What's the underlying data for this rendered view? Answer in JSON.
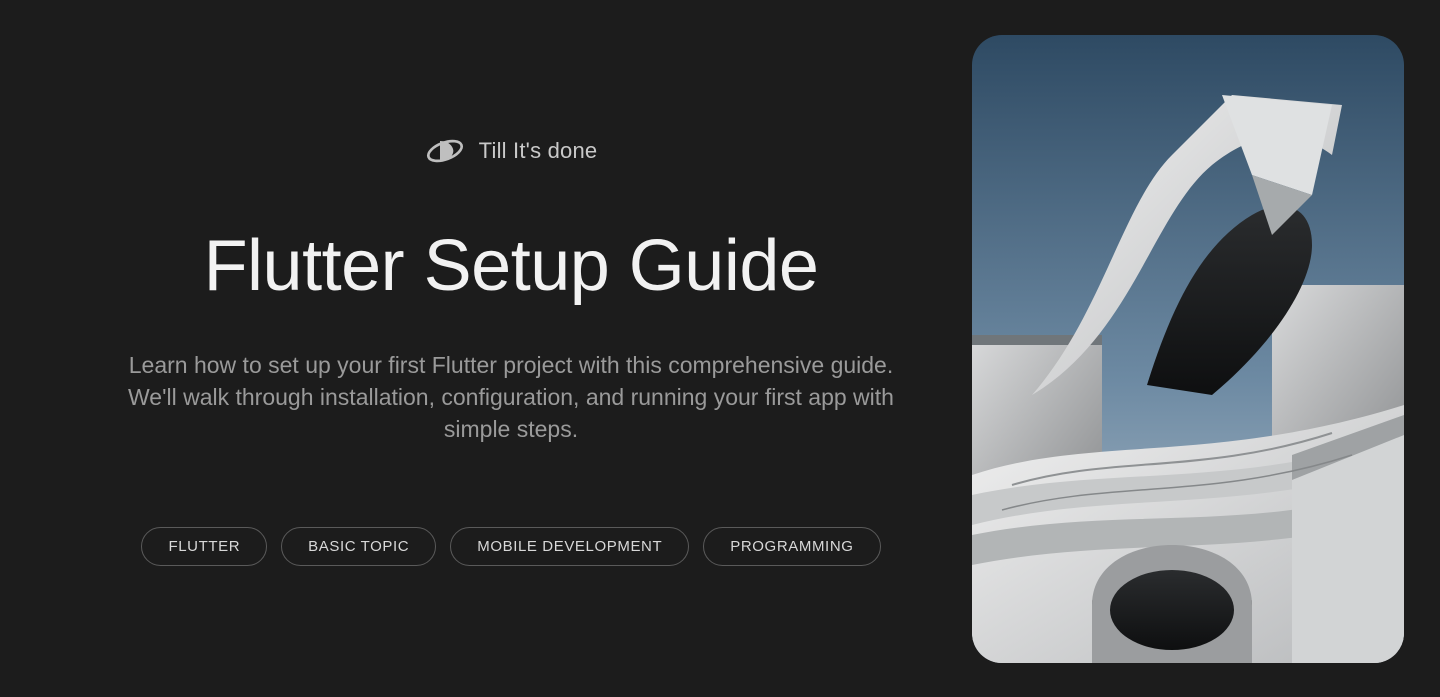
{
  "brand": {
    "name": "Till It's done",
    "icon": "orbit-d-icon"
  },
  "page": {
    "title": "Flutter Setup Guide",
    "subtitle": "Learn how to set up your first Flutter project with this comprehensive guide. We'll walk through installation, configuration, and running your first app with simple steps."
  },
  "tags": [
    "FLUTTER",
    "BASIC TOPIC",
    "MOBILE DEVELOPMENT",
    "PROGRAMMING"
  ],
  "hero_image": {
    "description": "modern-concrete-architecture"
  },
  "colors": {
    "background": "#1c1c1c",
    "text_primary": "#f2f2f2",
    "text_secondary": "#9a9a9a",
    "border": "#5a5a5a"
  }
}
